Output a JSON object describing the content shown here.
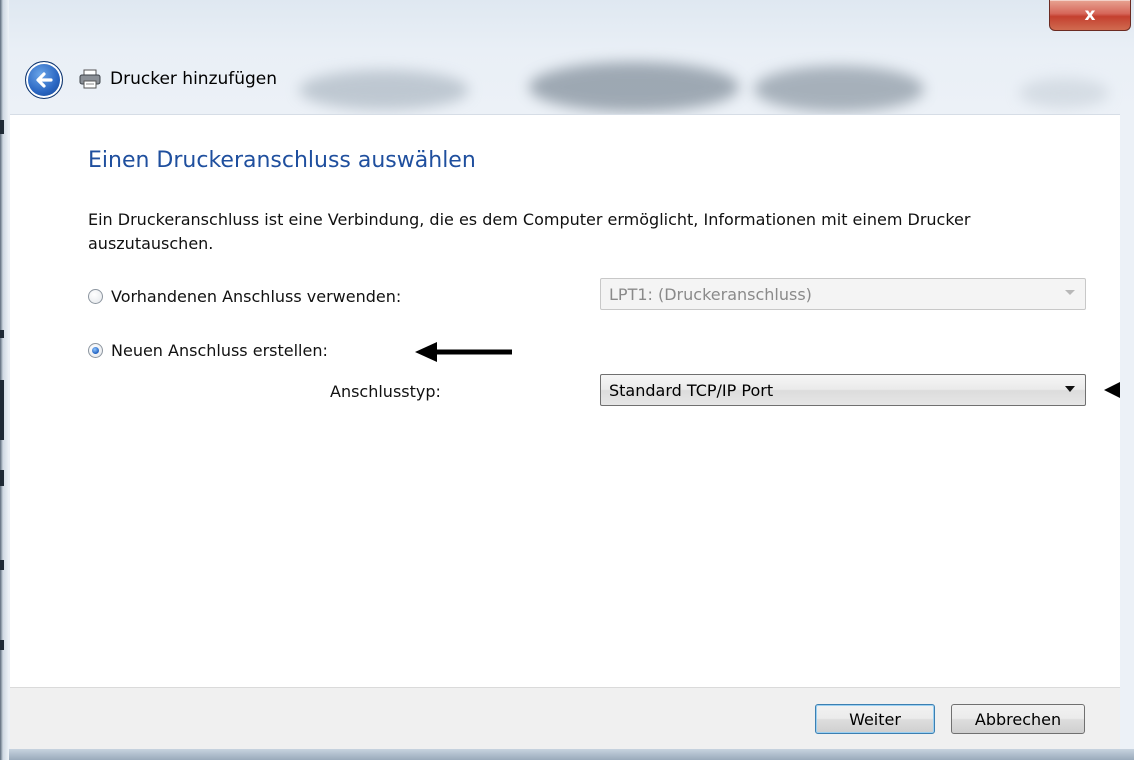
{
  "window": {
    "title": "Drucker hinzufügen",
    "close_label": "x"
  },
  "page": {
    "heading": "Einen Druckeranschluss auswählen",
    "description": "Ein Druckeranschluss ist eine Verbindung, die es dem Computer ermöglicht, Informationen mit einem Drucker auszutauschen."
  },
  "options": {
    "existing_label": "Vorhandenen Anschluss verwenden:",
    "existing_value": "LPT1: (Druckeranschluss)",
    "existing_selected": false,
    "new_label": "Neuen Anschluss erstellen:",
    "new_selected": true,
    "port_type_label": "Anschlusstyp:",
    "port_type_value": "Standard TCP/IP Port"
  },
  "buttons": {
    "next": "Weiter",
    "cancel": "Abbrechen"
  },
  "icons": {
    "back": "back-arrow-icon",
    "printer": "printer-icon",
    "close": "close-icon"
  },
  "colors": {
    "heading": "#1f4f9e",
    "close_button": "#c4402f"
  }
}
